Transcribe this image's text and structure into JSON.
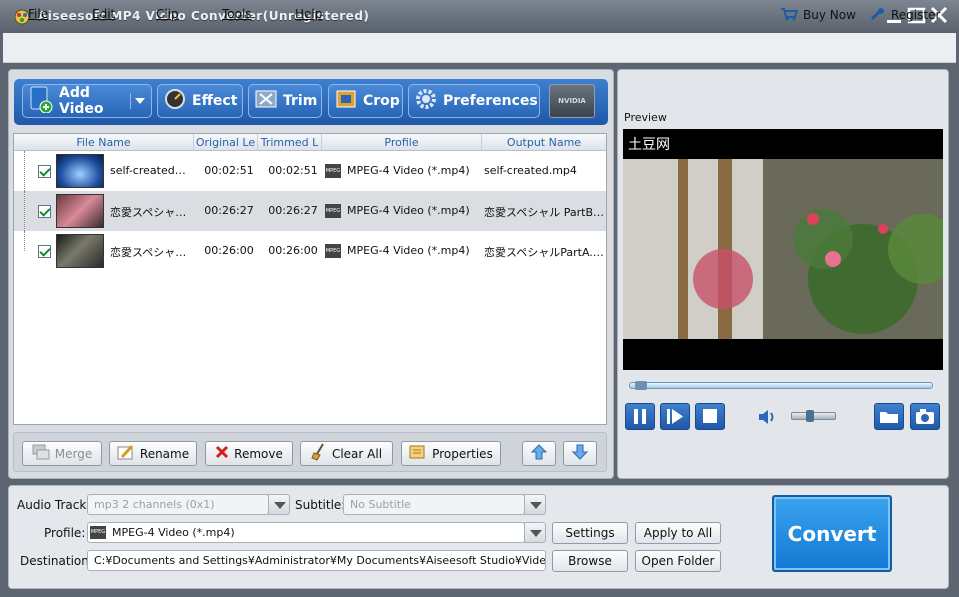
{
  "window": {
    "title": "Aiseesoft MP4 Video Converter(Unregistered)"
  },
  "menu": {
    "file": "File",
    "edit": "Edit",
    "clip": "Clip",
    "tools": "Tools",
    "help": "Help",
    "buy_now": "Buy Now",
    "register": "Register"
  },
  "toolbar": {
    "add_video": "Add Video",
    "effect": "Effect",
    "trim": "Trim",
    "crop": "Crop",
    "preferences": "Preferences",
    "nvidia": "NVIDIA"
  },
  "file_list": {
    "columns": [
      "File Name",
      "Original Le",
      "Trimmed L",
      "Profile",
      "Output Name"
    ],
    "rows": [
      {
        "name": "self-created…",
        "original": "00:02:51",
        "trimmed": "00:02:51",
        "profile": "MPEG-4 Video (*.mp4)",
        "output": "self-created.mp4",
        "checked": true,
        "selected": false
      },
      {
        "name": "恋愛スペシャ…",
        "original": "00:26:27",
        "trimmed": "00:26:27",
        "profile": "MPEG-4 Video (*.mp4)",
        "output": "恋愛スペシャル PartB.…",
        "checked": true,
        "selected": true
      },
      {
        "name": "恋愛スペシャ…",
        "original": "00:26:00",
        "trimmed": "00:26:00",
        "profile": "MPEG-4 Video (*.mp4)",
        "output": "恋愛スペシャルPartA.…",
        "checked": true,
        "selected": false
      }
    ]
  },
  "list_buttons": {
    "merge": "Merge",
    "rename": "Rename",
    "remove": "Remove",
    "clear_all": "Clear All",
    "properties": "Properties"
  },
  "preview": {
    "label": "Preview",
    "caption": "土豆网",
    "progress": 0.02,
    "volume": 0.4
  },
  "settings": {
    "audio_track_label": "Audio Track:",
    "audio_track_value": "mp3 2 channels (0x1)",
    "subtitle_label": "Subtitle:",
    "subtitle_value": "No Subtitle",
    "profile_label": "Profile:",
    "profile_value": "MPEG-4 Video (*.mp4)",
    "destination_label": "Destination:",
    "destination_value": "C:¥Documents and Settings¥Administrator¥My Documents¥Aiseesoft Studio¥Video",
    "settings_button": "Settings",
    "apply_to_all_button": "Apply to All",
    "browse_button": "Browse",
    "open_folder_button": "Open Folder",
    "convert_button": "Convert"
  },
  "colors": {
    "accent": "#1f6fc8",
    "title_bar": "#6b747e",
    "convert": "#2a8fe6"
  }
}
